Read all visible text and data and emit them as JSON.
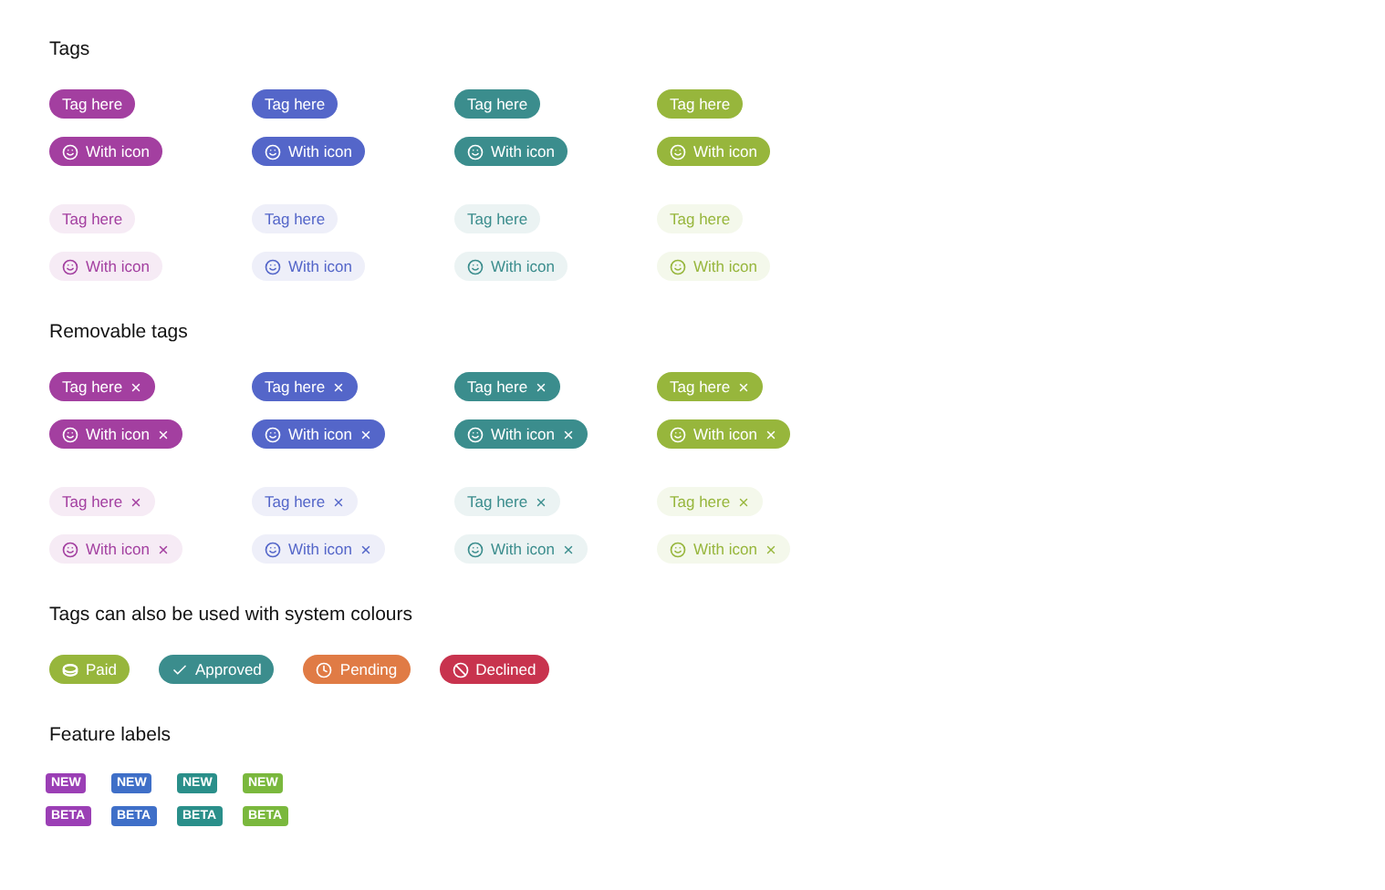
{
  "tag_sections": [
    {
      "title": "Tags",
      "removable": false,
      "blocks": [
        {
          "kind": "solid",
          "rows": [
            [
              {
                "text": "Tag here",
                "color": "#a33fa0",
                "kind": "plain"
              },
              {
                "text": "Tag here",
                "color": "#5466c9",
                "kind": "plain"
              },
              {
                "text": "Tag here",
                "color": "#3b8d8d",
                "kind": "plain"
              },
              {
                "text": "Tag here",
                "color": "#97b63c",
                "kind": "plain"
              }
            ],
            [
              {
                "text": "With icon",
                "color": "#a33fa0",
                "kind": "iconic"
              },
              {
                "text": "With icon",
                "color": "#5466c9",
                "kind": "iconic"
              },
              {
                "text": "With icon",
                "color": "#3b8d8d",
                "kind": "iconic"
              },
              {
                "text": "With icon",
                "color": "#97b63c",
                "kind": "iconic"
              }
            ]
          ]
        },
        {
          "kind": "light",
          "rows": [
            [
              {
                "text": "Tag here",
                "color": "#a33fa0",
                "kind": "plain"
              },
              {
                "text": "Tag here",
                "color": "#5466c9",
                "kind": "plain"
              },
              {
                "text": "Tag here",
                "color": "#3b8d8d",
                "kind": "plain"
              },
              {
                "text": "Tag here",
                "color": "#97b63c",
                "kind": "plain"
              }
            ],
            [
              {
                "text": "With icon",
                "color": "#a33fa0",
                "kind": "iconic"
              },
              {
                "text": "With icon",
                "color": "#5466c9",
                "kind": "iconic"
              },
              {
                "text": "With icon",
                "color": "#3b8d8d",
                "kind": "iconic"
              },
              {
                "text": "With icon",
                "color": "#97b63c",
                "kind": "iconic"
              }
            ]
          ]
        }
      ]
    },
    {
      "title": "Removable tags",
      "removable": true,
      "blocks": [
        {
          "kind": "solid",
          "rows": [
            [
              {
                "text": "Tag here",
                "color": "#a33fa0",
                "kind": "plain"
              },
              {
                "text": "Tag here",
                "color": "#5466c9",
                "kind": "plain"
              },
              {
                "text": "Tag here",
                "color": "#3b8d8d",
                "kind": "plain"
              },
              {
                "text": "Tag here",
                "color": "#97b63c",
                "kind": "plain"
              }
            ],
            [
              {
                "text": "With icon",
                "color": "#a33fa0",
                "kind": "iconic"
              },
              {
                "text": "With icon",
                "color": "#5466c9",
                "kind": "iconic"
              },
              {
                "text": "With icon",
                "color": "#3b8d8d",
                "kind": "iconic"
              },
              {
                "text": "With icon",
                "color": "#97b63c",
                "kind": "iconic"
              }
            ]
          ]
        },
        {
          "kind": "light",
          "rows": [
            [
              {
                "text": "Tag here",
                "color": "#a33fa0",
                "kind": "plain"
              },
              {
                "text": "Tag here",
                "color": "#5466c9",
                "kind": "plain"
              },
              {
                "text": "Tag here",
                "color": "#3b8d8d",
                "kind": "plain"
              },
              {
                "text": "Tag here",
                "color": "#97b63c",
                "kind": "plain"
              }
            ],
            [
              {
                "text": "With icon",
                "color": "#a33fa0",
                "kind": "iconic"
              },
              {
                "text": "With icon",
                "color": "#5466c9",
                "kind": "iconic"
              },
              {
                "text": "With icon",
                "color": "#3b8d8d",
                "kind": "iconic"
              },
              {
                "text": "With icon",
                "color": "#97b63c",
                "kind": "iconic"
              }
            ]
          ]
        }
      ]
    }
  ],
  "system_section": {
    "title": "Tags can also be used with system colours",
    "tags": [
      {
        "text": "Paid",
        "color": "#97b63c"
      },
      {
        "text": "Approved",
        "color": "#3b8d8d"
      },
      {
        "text": "Pending",
        "color": "#e07b45"
      },
      {
        "text": "Declined",
        "color": "#c8334e"
      }
    ]
  },
  "feature_section": {
    "title": "Feature labels",
    "rows": [
      [
        {
          "text": "NEW",
          "color": "#9b3fb5"
        },
        {
          "text": "NEW",
          "color": "#3f6fc8"
        },
        {
          "text": "NEW",
          "color": "#2a8f8a"
        },
        {
          "text": "NEW",
          "color": "#7ab83d"
        }
      ],
      [
        {
          "text": "BETA",
          "color": "#9b3fb5"
        },
        {
          "text": "BETA",
          "color": "#3f6fc8"
        },
        {
          "text": "BETA",
          "color": "#2a8f8a"
        },
        {
          "text": "BETA",
          "color": "#7ab83d"
        }
      ]
    ]
  }
}
